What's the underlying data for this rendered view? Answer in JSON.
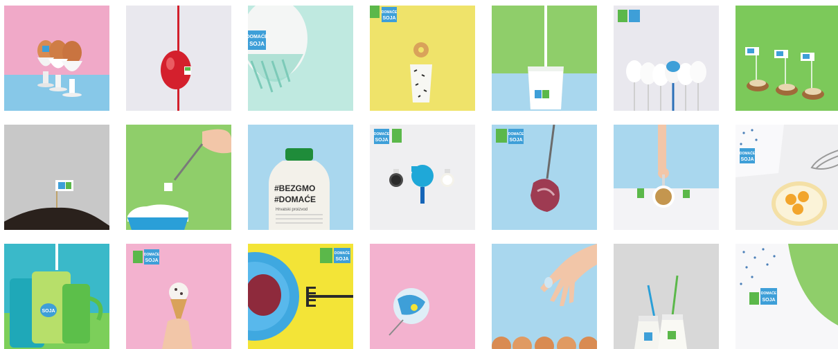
{
  "gallery": {
    "tiles": [
      {
        "row": 1,
        "col": 1,
        "subject": "eggs-in-egg-cups",
        "background": "#f0a9c8"
      },
      {
        "row": 1,
        "col": 2,
        "subject": "red-dripping-egg",
        "background": "#e9e8ee"
      },
      {
        "row": 1,
        "col": 3,
        "subject": "egg-in-glass-bowl",
        "background": "#bfe9e0"
      },
      {
        "row": 1,
        "col": 4,
        "subject": "donut-on-cup",
        "background": "#efe36a"
      },
      {
        "row": 1,
        "col": 5,
        "subject": "milk-pouring-into-glass",
        "background": "#8fce6a"
      },
      {
        "row": 1,
        "col": 6,
        "subject": "egg-lollipops",
        "background": "#e9e8ee"
      },
      {
        "row": 1,
        "col": 7,
        "subject": "canapes-with-flags",
        "background": "#7cc95a"
      },
      {
        "row": 2,
        "col": 1,
        "subject": "flag-in-soil",
        "background": "#c8c8c8"
      },
      {
        "row": 2,
        "col": 2,
        "subject": "sugar-cubes-spoon",
        "background": "#8fce6a"
      },
      {
        "row": 2,
        "col": 3,
        "subject": "milk-bottle",
        "background": "#a9d7ee"
      },
      {
        "row": 2,
        "col": 4,
        "subject": "moka-pot-cups",
        "background": "#efeff1"
      },
      {
        "row": 2,
        "col": 5,
        "subject": "meat-on-fork",
        "background": "#a9d7ee"
      },
      {
        "row": 2,
        "col": 6,
        "subject": "hand-with-cereal-bowl",
        "background": "#a9d7ee"
      },
      {
        "row": 2,
        "col": 7,
        "subject": "eggs-bowl-whisk",
        "background": "#efeff1"
      },
      {
        "row": 3,
        "col": 1,
        "subject": "mugs-milk-pour",
        "background": "#3ab9c9"
      },
      {
        "row": 3,
        "col": 2,
        "subject": "ice-cream-cone",
        "background": "#f3b2cf"
      },
      {
        "row": 3,
        "col": 3,
        "subject": "plate-with-fork",
        "background": "#f3e437"
      },
      {
        "row": 3,
        "col": 4,
        "subject": "bowl-from-above",
        "background": "#f3b2cf"
      },
      {
        "row": 3,
        "col": 5,
        "subject": "hand-over-eggs",
        "background": "#a9d7ee"
      },
      {
        "row": 3,
        "col": 6,
        "subject": "milk-bottles-straws",
        "background": "#d8d8d8"
      },
      {
        "row": 3,
        "col": 7,
        "subject": "patterned-cloth",
        "background": "#8fce6a"
      }
    ],
    "label_line1": "DOMAĆE",
    "label_line2": "SOJA",
    "bottle_hashtag1": "#BEZGMO",
    "bottle_hashtag2": "#DOMAĆE",
    "bottle_small": "Hrvatski proizvod"
  }
}
